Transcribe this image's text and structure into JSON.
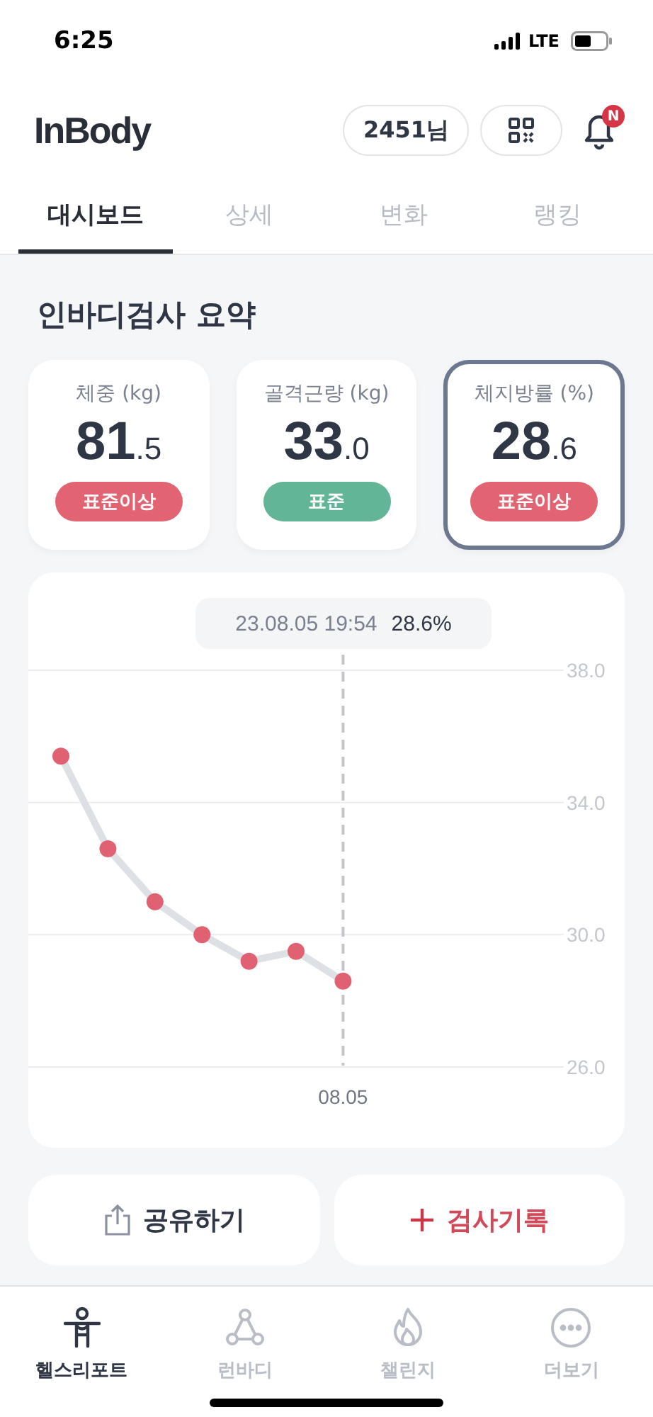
{
  "status_bar": {
    "time": "6:25",
    "network": "LTE"
  },
  "header": {
    "logo": "InBody",
    "user_chip": "2451님",
    "notification_badge": "N"
  },
  "tabs": [
    {
      "label": "대시보드",
      "selected": true
    },
    {
      "label": "상세",
      "selected": false
    },
    {
      "label": "변화",
      "selected": false
    },
    {
      "label": "랭킹",
      "selected": false
    }
  ],
  "summary": {
    "title": "인바디검사 요약",
    "cards": [
      {
        "label": "체중 (kg)",
        "value": "81.5",
        "badge": "표준이상",
        "color": "#e26473",
        "selected": false
      },
      {
        "label": "골격근량 (kg)",
        "value": "33.0",
        "badge": "표준",
        "color": "#62b596",
        "selected": false
      },
      {
        "label": "체지방률 (%)",
        "value": "28.6",
        "badge": "표준이상",
        "color": "#e26473",
        "selected": true
      }
    ]
  },
  "chart": {
    "tooltip": {
      "date": "23.08.05 19:54",
      "value": "28.6%"
    },
    "cursor_label": "08.05",
    "chart_data": {
      "type": "line",
      "series": [
        {
          "color": "#e06272",
          "marker": true,
          "values": [
            35.4,
            32.6,
            31.0,
            30.0,
            29.2,
            29.5,
            28.6
          ]
        }
      ],
      "ylim": [
        26,
        38
      ],
      "yticks": [
        {
          "value": 38,
          "label": "38.0"
        },
        {
          "value": 34,
          "label": "34.0"
        },
        {
          "value": 30,
          "label": "30.0"
        },
        {
          "value": 26,
          "label": "26.0"
        }
      ]
    }
  },
  "actions": [
    {
      "label": "공유하기",
      "kind": "share"
    },
    {
      "label": "검사기록",
      "kind": "add"
    }
  ],
  "bottom_nav": [
    {
      "label": "헬스리포트",
      "kind": "person",
      "selected": true
    },
    {
      "label": "런바디",
      "kind": "nodes",
      "selected": false
    },
    {
      "label": "챌린지",
      "kind": "flame",
      "selected": false
    },
    {
      "label": "더보기",
      "kind": "more",
      "selected": false
    }
  ]
}
